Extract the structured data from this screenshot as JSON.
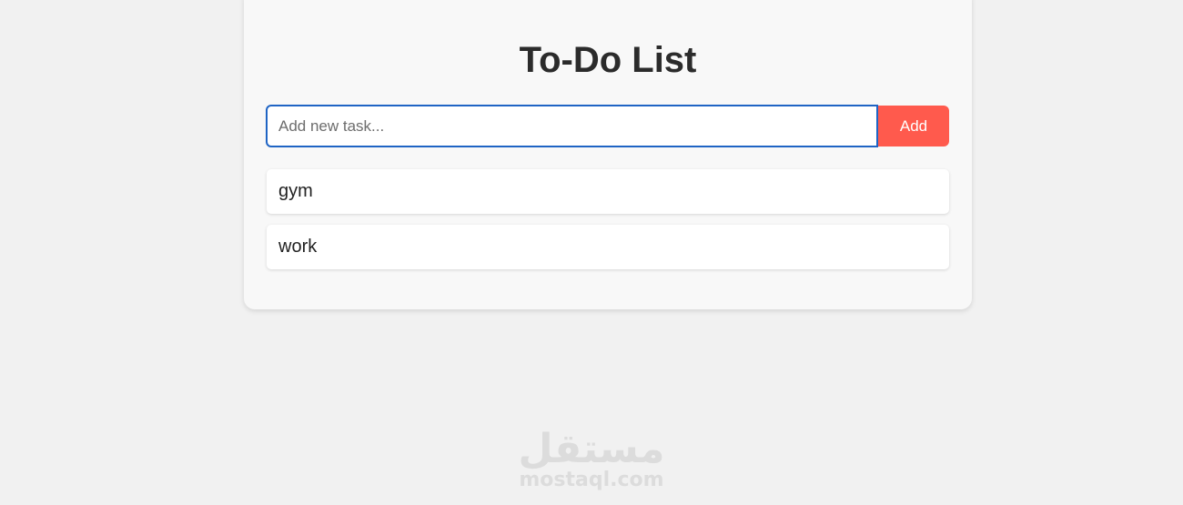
{
  "app": {
    "title": "To-Do List"
  },
  "new_task": {
    "placeholder": "Add new task...",
    "value": "",
    "add_label": "Add"
  },
  "tasks": [
    {
      "label": "gym"
    },
    {
      "label": "work"
    }
  ],
  "watermark": {
    "arabic": "مستقل",
    "latin": "mostaql.com"
  },
  "colors": {
    "background": "#f1f1f1",
    "card": "#f8f8f8",
    "accent": "#ff5a4d",
    "input_focus_border": "#1f64c4",
    "title": "#2b2b2b"
  }
}
